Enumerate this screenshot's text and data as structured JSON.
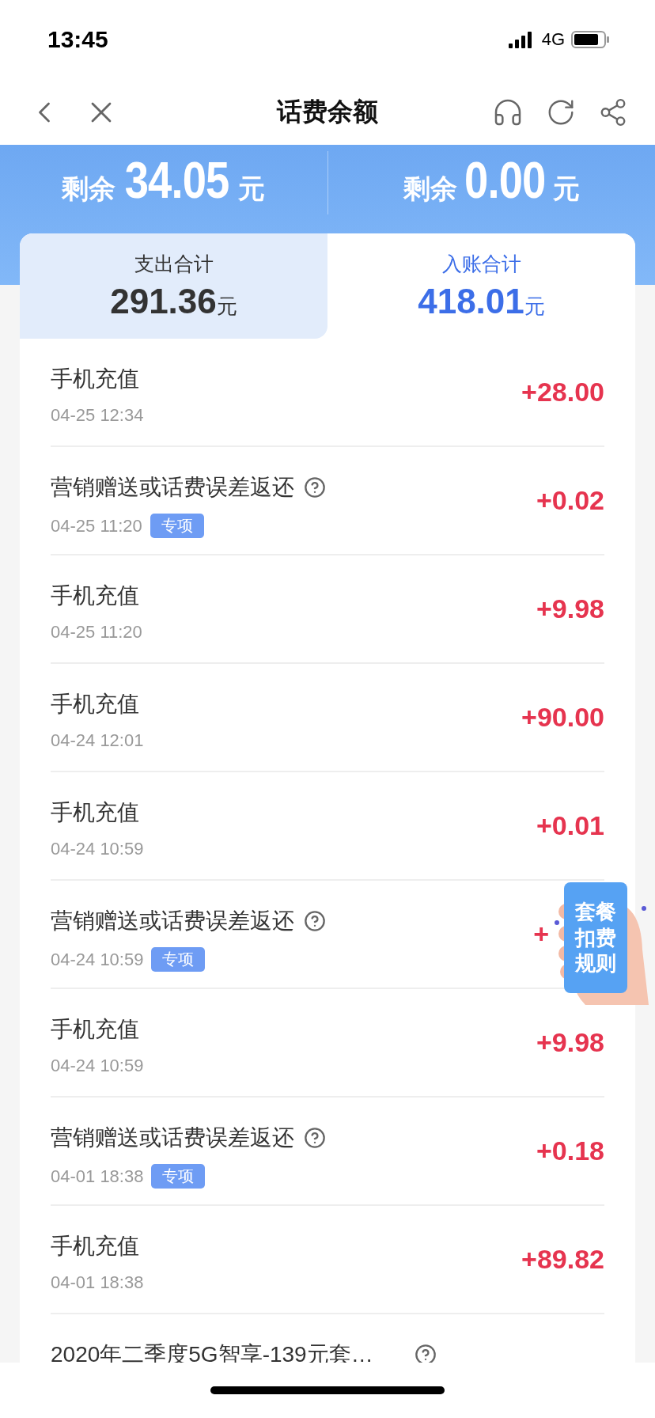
{
  "status_bar": {
    "time": "13:45",
    "network": "4G"
  },
  "nav": {
    "title": "话费余额"
  },
  "balances": [
    {
      "prefix": "剩余",
      "amount": "34.05",
      "unit": "元"
    },
    {
      "prefix": "剩余",
      "amount": "0.00",
      "unit": "元"
    }
  ],
  "tabs": [
    {
      "label": "支出合计",
      "amount": "291.36",
      "unit": "元",
      "selected": false
    },
    {
      "label": "入账合计",
      "amount": "418.01",
      "unit": "元",
      "selected": true
    }
  ],
  "rows": [
    {
      "title": "手机充值",
      "help_icon": false,
      "date": "04-25 12:34",
      "amount": "+28.00"
    },
    {
      "title": "营销赠送或话费误差返还",
      "help_icon": true,
      "date": "04-25 11:20",
      "tag": "专项",
      "amount": "+0.02"
    },
    {
      "title": "手机充值",
      "help_icon": false,
      "date": "04-25 11:20",
      "amount": "+9.98"
    },
    {
      "title": "手机充值",
      "help_icon": false,
      "date": "04-24 12:01",
      "amount": "+90.00"
    },
    {
      "title": "手机充值",
      "help_icon": false,
      "date": "04-24 10:59",
      "amount": "+0.01"
    },
    {
      "title": "营销赠送或话费误差返还",
      "help_icon": true,
      "date": "04-24 10:59",
      "tag": "专项",
      "amount": "+",
      "covered": true
    },
    {
      "title": "手机充值",
      "help_icon": false,
      "date": "04-24 10:59",
      "amount": "+9.98"
    },
    {
      "title": "营销赠送或话费误差返还",
      "help_icon": true,
      "date": "04-01 18:38",
      "tag": "专项",
      "amount": "+0.18"
    },
    {
      "title": "手机充值",
      "help_icon": false,
      "date": "04-01 18:38",
      "amount": "+89.82"
    },
    {
      "title": "2020年二季度5G智享-139元套…",
      "help_icon": true
    }
  ],
  "floating_button": {
    "label": "套餐扣费规则"
  }
}
